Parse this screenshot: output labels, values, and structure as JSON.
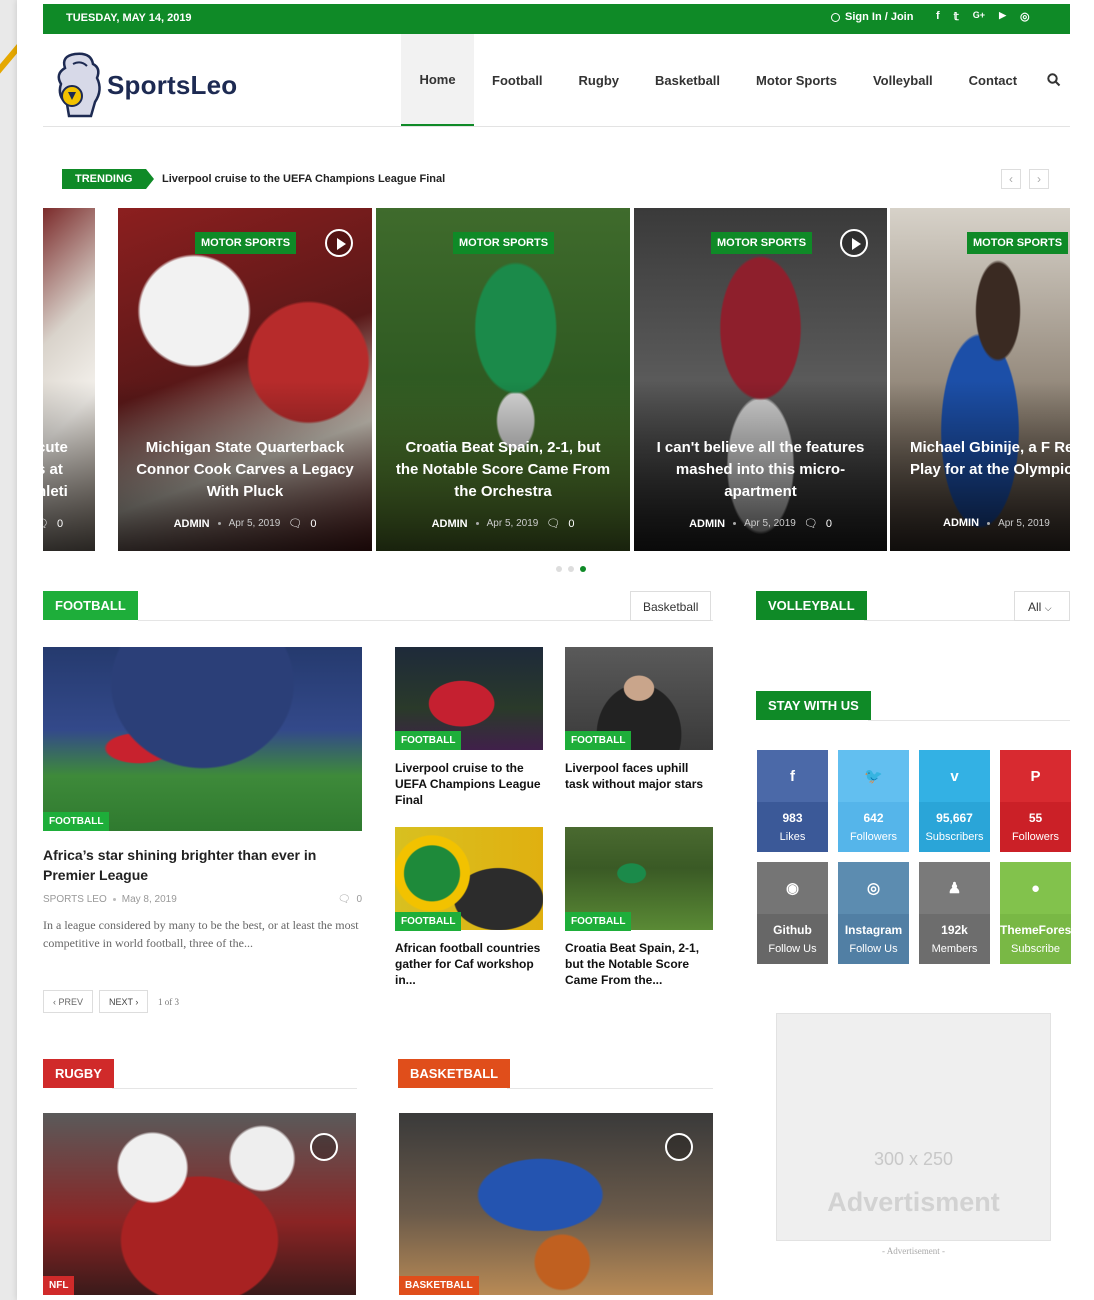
{
  "topbar": {
    "date": "TUESDAY, MAY 14, 2019",
    "signin": "Sign In / Join",
    "socials": [
      "f",
      "𝕥",
      "G+",
      "▶",
      "◎"
    ]
  },
  "brand": {
    "name": "SportsLeo"
  },
  "nav": [
    "Home",
    "Football",
    "Rugby",
    "Basketball",
    "Motor Sports",
    "Volleyball",
    "Contact"
  ],
  "trending": {
    "label": "TRENDING",
    "headline": "Liverpool cruise to the UEFA Champions League Final",
    "prev": "‹",
    "next": "›"
  },
  "slides": [
    {
      "category": "",
      "title": "cute\ns at\nhleti",
      "author": "",
      "date": "",
      "comments": "0"
    },
    {
      "category": "MOTOR SPORTS",
      "title": "Michigan State Quarterback Connor Cook Carves a Legacy With Pluck",
      "author": "ADMIN",
      "date": "Apr 5, 2019",
      "comments": "0"
    },
    {
      "category": "MOTOR SPORTS",
      "title": "Croatia Beat Spain, 2-1, but the Notable Score Came From the Orchestra",
      "author": "ADMIN",
      "date": "Apr 5, 2019",
      "comments": "0"
    },
    {
      "category": "MOTOR SPORTS",
      "title": "I can't believe all the features mashed into this micro-apartment",
      "author": "ADMIN",
      "date": "Apr 5, 2019",
      "comments": "0"
    },
    {
      "category": "MOTOR SPORTS",
      "title": "Michael Gbinije, a F Recruit, May Play for at the Olympics",
      "author": "ADMIN",
      "date": "Apr 5, 2019",
      "comments": ""
    }
  ],
  "football": {
    "heading": "FOOTBALL",
    "filter": "Basketball",
    "main": {
      "tag": "FOOTBALL",
      "title": "Africa’s star shining brighter than ever in Premier League",
      "author": "SPORTS LEO",
      "date": "May 8, 2019",
      "comments": "0",
      "excerpt": "In a league considered by many to be the best, or at least the most competitive in world football, three of the..."
    },
    "small": [
      {
        "tag": "FOOTBALL",
        "title": "Liverpool cruise to the UEFA Champions League Final"
      },
      {
        "tag": "FOOTBALL",
        "title": "Liverpool faces uphill task without major stars"
      },
      {
        "tag": "FOOTBALL",
        "title": "African football countries gather for Caf workshop in..."
      },
      {
        "tag": "FOOTBALL",
        "title": "Croatia Beat Spain, 2-1, but the Notable Score Came From the..."
      }
    ],
    "pager": {
      "prev": "‹ PREV",
      "next": "NEXT ›",
      "status": "1 of 3"
    }
  },
  "volleyball": {
    "heading": "VOLLEYBALL",
    "filter": "All"
  },
  "stay": {
    "heading": "STAY WITH US",
    "items": [
      {
        "icon": "f",
        "count": "983",
        "label": "Likes",
        "color": "#3b5998",
        "top": "#4b69a8"
      },
      {
        "icon": "🐦",
        "count": "642",
        "label": "Followers",
        "color": "#55b5ea",
        "top": "#62bff0"
      },
      {
        "icon": "v",
        "count": "95,667",
        "label": "Subscribers",
        "color": "#2aa5d8",
        "top": "#33b1e4"
      },
      {
        "icon": "P",
        "count": "55",
        "label": "Followers",
        "color": "#cb2027",
        "top": "#d82a30"
      },
      {
        "icon": "◉",
        "count": "Github",
        "label": "Follow Us",
        "color": "#676767",
        "top": "#757575"
      },
      {
        "icon": "◎",
        "count": "Instagram",
        "label": "Follow Us",
        "color": "#517fa4",
        "top": "#5c8cb0"
      },
      {
        "icon": "♟",
        "count": "192k",
        "label": "Members",
        "color": "#6d6d6d",
        "top": "#7a7a7a"
      },
      {
        "icon": "●",
        "count": "ThemeForest",
        "label": "Subscribe",
        "color": "#79b845",
        "top": "#82c24c"
      }
    ]
  },
  "rugby": {
    "heading": "RUGBY",
    "tag": "NFL"
  },
  "basketball": {
    "heading": "BASKETBALL",
    "tag": "BASKETBALL"
  },
  "ad": {
    "size": "300 x 250",
    "label": "Advertisment",
    "caption": "- Advertisement -"
  },
  "colors": {
    "green": "#0f8a27",
    "tag_green": "#1eae3a",
    "rugby": "#d02a2a",
    "basketball": "#e04e1b"
  }
}
